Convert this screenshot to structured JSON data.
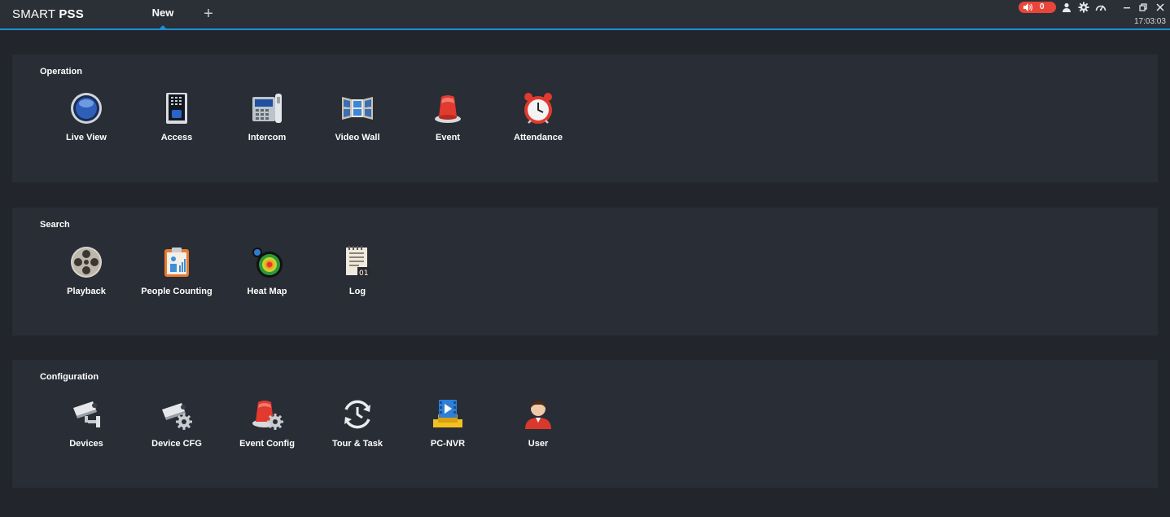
{
  "titlebar": {
    "brand_part1": "SMART",
    "brand_part2": "PSS",
    "active_tab": "New",
    "add_tab_symbol": "+",
    "alarm_count": "0",
    "clock": "17:03:03",
    "icons": [
      "speaker-icon",
      "user-icon",
      "gear-icon",
      "gauge-icon",
      "minimize-icon",
      "restore-icon",
      "close-icon"
    ],
    "accent_color": "#1f8ed8",
    "alarm_color": "#e8463a"
  },
  "sections": [
    {
      "title": "Operation",
      "items": [
        {
          "label": "Live View",
          "icon": "live-view-icon"
        },
        {
          "label": "Access",
          "icon": "access-icon"
        },
        {
          "label": "Intercom",
          "icon": "intercom-icon"
        },
        {
          "label": "Video Wall",
          "icon": "video-wall-icon"
        },
        {
          "label": "Event",
          "icon": "event-icon"
        },
        {
          "label": "Attendance",
          "icon": "attendance-icon"
        }
      ]
    },
    {
      "title": "Search",
      "items": [
        {
          "label": "Playback",
          "icon": "playback-icon"
        },
        {
          "label": "People Counting",
          "icon": "people-counting-icon"
        },
        {
          "label": "Heat Map",
          "icon": "heat-map-icon"
        },
        {
          "label": "Log",
          "icon": "log-icon"
        }
      ]
    },
    {
      "title": "Configuration",
      "items": [
        {
          "label": "Devices",
          "icon": "devices-icon"
        },
        {
          "label": "Device CFG",
          "icon": "device-cfg-icon"
        },
        {
          "label": "Event Config",
          "icon": "event-config-icon"
        },
        {
          "label": "Tour & Task",
          "icon": "tour-task-icon"
        },
        {
          "label": "PC-NVR",
          "icon": "pc-nvr-icon"
        },
        {
          "label": "User",
          "icon": "user-icon"
        }
      ]
    }
  ]
}
